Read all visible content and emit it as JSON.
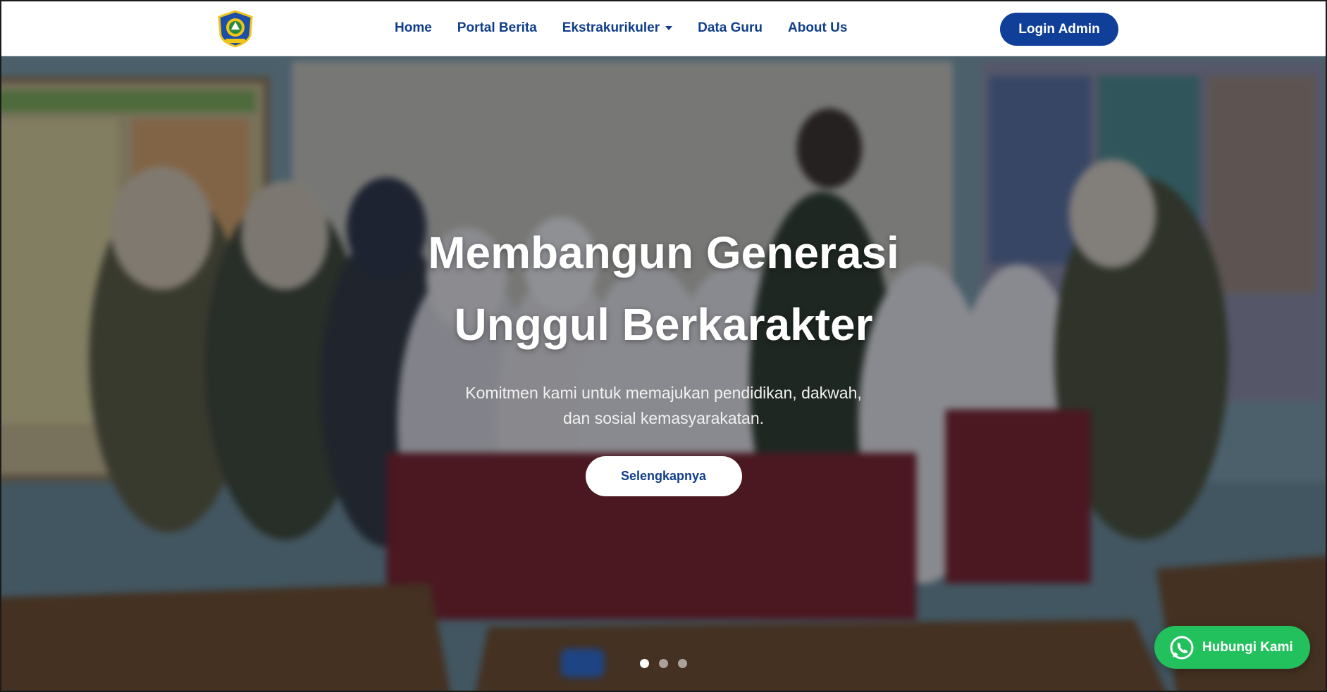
{
  "nav": {
    "items": [
      {
        "label": "Home"
      },
      {
        "label": "Portal Berita"
      },
      {
        "label": "Ekstrakurikuler"
      },
      {
        "label": "Data Guru"
      },
      {
        "label": "About Us"
      }
    ],
    "login_label": "Login Admin",
    "logo_icon": "school-crest-icon"
  },
  "hero": {
    "title_line1": "Membangun Generasi",
    "title_line2": "Unggul Berkarakter",
    "subtitle_line1": "Komitmen kami untuk memajukan pendidikan, dakwah,",
    "subtitle_line2": "dan sosial kemasyarakatan.",
    "cta_label": "Selengkapnya",
    "slide_count": 3,
    "active_slide": 1
  },
  "whatsapp": {
    "label": "Hubungi Kami",
    "icon": "whatsapp-icon",
    "color": "#22c15e"
  },
  "colors": {
    "brand": "#103e8a",
    "button": "#0f3f99"
  }
}
